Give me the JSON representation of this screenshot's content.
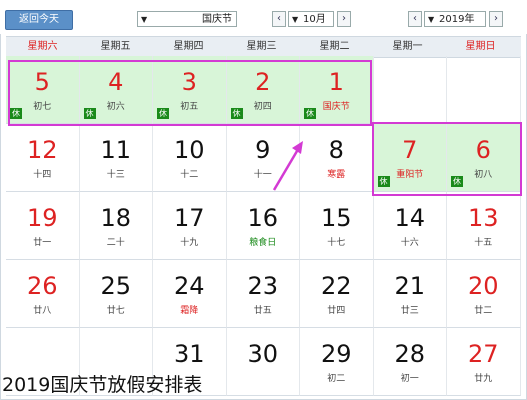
{
  "toolbar": {
    "today_label": "返回今天",
    "holiday_select": "国庆节",
    "month_select": "10月",
    "year_select": "2019年",
    "prev": "‹",
    "next": "›"
  },
  "weekdays": [
    "星期六",
    "星期五",
    "星期四",
    "星期三",
    "星期二",
    "星期一",
    "星期日"
  ],
  "rows": [
    [
      {
        "d": "5",
        "s": "初七",
        "red": true,
        "hol": true,
        "rest": "休"
      },
      {
        "d": "4",
        "s": "初六",
        "red": true,
        "hol": true,
        "rest": "休"
      },
      {
        "d": "3",
        "s": "初五",
        "red": true,
        "hol": true,
        "rest": "休"
      },
      {
        "d": "2",
        "s": "初四",
        "red": true,
        "hol": true,
        "rest": "休"
      },
      {
        "d": "1",
        "s": "国庆节",
        "red": true,
        "hol": true,
        "rest": "休",
        "sred": true
      },
      {
        "d": "",
        "s": ""
      },
      {
        "d": "",
        "s": ""
      }
    ],
    [
      {
        "d": "12",
        "s": "十四",
        "red": true
      },
      {
        "d": "11",
        "s": "十三"
      },
      {
        "d": "10",
        "s": "十二"
      },
      {
        "d": "9",
        "s": "十一"
      },
      {
        "d": "8",
        "s": "寒露",
        "sred": true
      },
      {
        "d": "7",
        "s": "重阳节",
        "red": true,
        "hol": true,
        "rest": "休",
        "sred": true
      },
      {
        "d": "6",
        "s": "初八",
        "red": true,
        "hol": true,
        "rest": "休"
      }
    ],
    [
      {
        "d": "19",
        "s": "廿一",
        "red": true
      },
      {
        "d": "18",
        "s": "二十"
      },
      {
        "d": "17",
        "s": "十九"
      },
      {
        "d": "16",
        "s": "粮食日",
        "sgreen": true
      },
      {
        "d": "15",
        "s": "十七"
      },
      {
        "d": "14",
        "s": "十六"
      },
      {
        "d": "13",
        "s": "十五",
        "red": true
      }
    ],
    [
      {
        "d": "26",
        "s": "廿八",
        "red": true
      },
      {
        "d": "25",
        "s": "廿七"
      },
      {
        "d": "24",
        "s": "霜降",
        "sred": true
      },
      {
        "d": "23",
        "s": "廿五"
      },
      {
        "d": "22",
        "s": "廿四"
      },
      {
        "d": "21",
        "s": "廿三"
      },
      {
        "d": "20",
        "s": "廿二",
        "red": true
      }
    ],
    [
      {
        "d": "",
        "s": ""
      },
      {
        "d": "",
        "s": ""
      },
      {
        "d": "31",
        "s": ""
      },
      {
        "d": "30",
        "s": ""
      },
      {
        "d": "29",
        "s": "初二"
      },
      {
        "d": "28",
        "s": "初一"
      },
      {
        "d": "27",
        "s": "廿九",
        "red": true
      }
    ]
  ],
  "caption": "2019国庆节放假安排表"
}
